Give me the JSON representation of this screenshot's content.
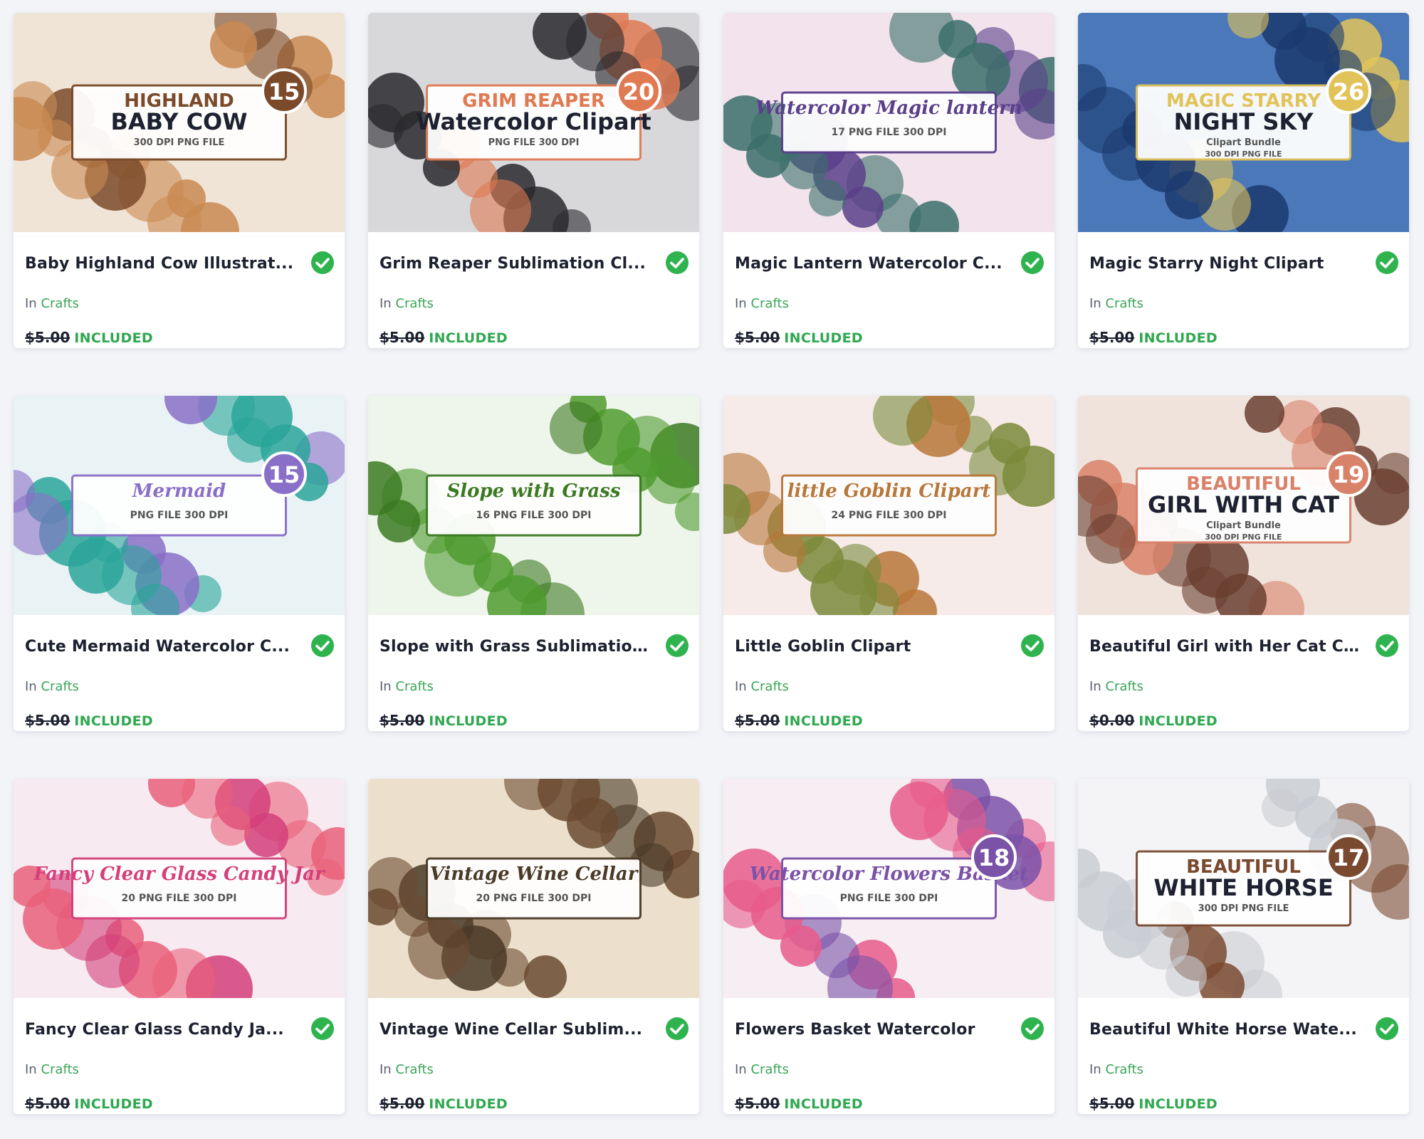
{
  "products": [
    {
      "title": "Baby Highland Cow Illustrat...",
      "category_prefix": "In",
      "category": "Crafts",
      "old_price": "$5.00",
      "status": "INCLUDED",
      "art": {
        "line1": "HIGHLAND",
        "line2": "BABY COW",
        "line3": "300 DPI PNG FILE",
        "count": "15",
        "bg1": "#c98a52",
        "bg2": "#efe4d6",
        "accent": "#7a4a2a"
      }
    },
    {
      "title": "Grim Reaper Sublimation Cl...",
      "category_prefix": "In",
      "category": "Crafts",
      "old_price": "$5.00",
      "status": "INCLUDED",
      "art": {
        "line1": "GRIM REAPER",
        "line2": "Watercolor Clipart",
        "line3": "PNG FILE 300 DPI",
        "count": "20",
        "bg1": "#2a2a2e",
        "bg2": "#d8d8da",
        "accent": "#e07a52"
      }
    },
    {
      "title": "Magic Lantern Watercolor C...",
      "category_prefix": "In",
      "category": "Crafts",
      "old_price": "$5.00",
      "status": "INCLUDED",
      "art": {
        "line1": "Watercolor Magic lantern",
        "line2": "",
        "line3": "17 PNG FILE 300 DPI",
        "count": "",
        "bg1": "#3b6f6a",
        "bg2": "#f2e3ec",
        "accent": "#5a3f8a"
      }
    },
    {
      "title": "Magic Starry Night Clipart",
      "category_prefix": "In",
      "category": "Crafts",
      "old_price": "$5.00",
      "status": "INCLUDED",
      "art": {
        "line1": "MAGIC STARRY",
        "line2": "NIGHT SKY",
        "line3": "Clipart Bundle",
        "line4": "300 DPI PNG FILE",
        "count": "26",
        "bg1": "#1b3a6e",
        "bg2": "#4a78b8",
        "accent": "#e2c35a"
      }
    },
    {
      "title": "Cute Mermaid Watercolor C...",
      "category_prefix": "In",
      "category": "Crafts",
      "old_price": "$5.00",
      "status": "INCLUDED",
      "art": {
        "line1": "Mermaid",
        "line2": "",
        "line3": "PNG FILE 300 DPI",
        "count": "15",
        "bg1": "#2aa59a",
        "bg2": "#e9f3f6",
        "accent": "#8a6fc8"
      }
    },
    {
      "title": "Slope with Grass Sublimatio...",
      "category_prefix": "In",
      "category": "Crafts",
      "old_price": "$5.00",
      "status": "INCLUDED",
      "art": {
        "line1": "Slope with Grass",
        "line2": "",
        "line3": "16 PNG FILE 300 DPI",
        "count": "",
        "bg1": "#4f9b2f",
        "bg2": "#eef5ea",
        "accent": "#3c7a22"
      }
    },
    {
      "title": "Little Goblin Clipart",
      "category_prefix": "In",
      "category": "Crafts",
      "old_price": "$5.00",
      "status": "INCLUDED",
      "art": {
        "line1": "little Goblin Clipart",
        "line2": "",
        "line3": "24 PNG FILE 300 DPI",
        "count": "",
        "bg1": "#7a8a3a",
        "bg2": "#f6ebe8",
        "accent": "#b8773a"
      }
    },
    {
      "title": "Beautiful Girl with Her Cat C...",
      "category_prefix": "In",
      "category": "Crafts",
      "old_price": "$0.00",
      "status": "INCLUDED",
      "art": {
        "line1": "BEAUTIFUL",
        "line2": "GIRL WITH CAT",
        "line3": "Clipart Bundle",
        "line4": "300 DPI PNG FILE",
        "count": "19",
        "bg1": "#6a4030",
        "bg2": "#f0e3dc",
        "accent": "#d9826a"
      }
    },
    {
      "title": "Fancy Clear Glass Candy Ja...",
      "category_prefix": "In",
      "category": "Crafts",
      "old_price": "$5.00",
      "status": "INCLUDED",
      "art": {
        "line1": "Fancy Clear Glass Candy Jar",
        "line2": "",
        "line3": "20 PNG FILE 300 DPI",
        "count": "",
        "bg1": "#e9607a",
        "bg2": "#f7eaf0",
        "accent": "#d4407a"
      }
    },
    {
      "title": "Vintage Wine Cellar Sublim...",
      "category_prefix": "In",
      "category": "Crafts",
      "old_price": "$5.00",
      "status": "INCLUDED",
      "art": {
        "line1": "Vintage Wine Cellar",
        "line2": "",
        "line3": "20 PNG FILE 300 DPI",
        "count": "",
        "bg1": "#6a4a30",
        "bg2": "#ece0cc",
        "accent": "#4a3a28"
      }
    },
    {
      "title": "Flowers Basket Watercolor",
      "category_prefix": "In",
      "category": "Crafts",
      "old_price": "$5.00",
      "status": "INCLUDED",
      "art": {
        "line1": "Watercolor Flowers Basket",
        "line2": "",
        "line3": "PNG FILE 300 DPI",
        "count": "18",
        "bg1": "#e75a8a",
        "bg2": "#f6eef2",
        "accent": "#7a52a8"
      }
    },
    {
      "title": "Beautiful White Horse Wate...",
      "category_prefix": "In",
      "category": "Crafts",
      "old_price": "$5.00",
      "status": "INCLUDED",
      "art": {
        "line1": "BEAUTIFUL",
        "line2": "WHITE HORSE",
        "line3": "300 DPI PNG FILE",
        "count": "17",
        "bg1": "#c9ccd2",
        "bg2": "#f4f4f6",
        "accent": "#7a4a30"
      }
    }
  ],
  "colors": {
    "page_bg": "#f3f4f8",
    "title": "#1d2130",
    "category_link": "#3aa556",
    "included": "#2fa84f",
    "check": "#2fb34f"
  },
  "icons": {
    "check": "check-circle-icon"
  }
}
